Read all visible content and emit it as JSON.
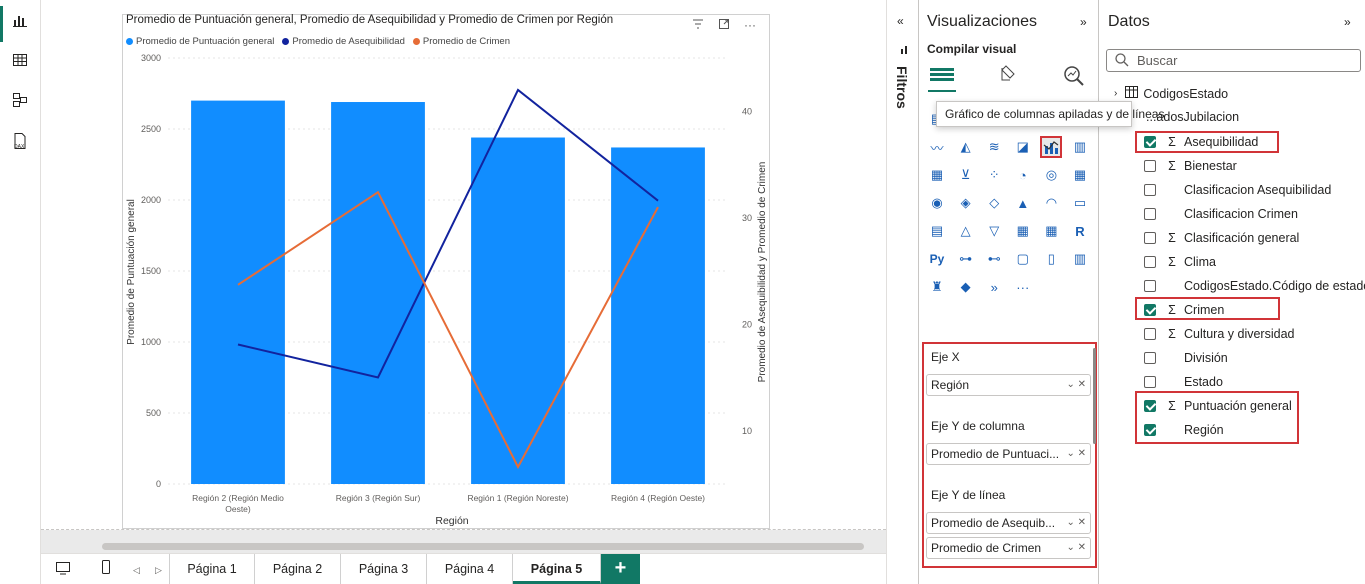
{
  "canvas_tabs": [
    "Página 1",
    "Página 2",
    "Página 3",
    "Página 4",
    "Página 5"
  ],
  "active_tab": "Página 5",
  "add_page_label": "+",
  "filters_label": "Filtros",
  "visualizations": {
    "title": "Visualizaciones",
    "build_visual_label": "Compilar visual",
    "tooltip": "Gráfico de columnas apiladas y de líneas",
    "more_label": "···",
    "wells": {
      "x_axis_label": "Eje X",
      "x_axis_field": "Región",
      "column_y_label": "Eje Y de columna",
      "column_y_field": "Promedio de Puntuaci...",
      "line_y_label": "Eje Y de línea",
      "line_y_fields": [
        "Promedio de Asequib...",
        "Promedio de Crimen"
      ]
    }
  },
  "data_pane": {
    "title": "Datos",
    "search_placeholder": "Buscar",
    "tables": [
      {
        "name": "CodigosEstado"
      },
      {
        "name": "...adosJubilacion"
      }
    ],
    "fields": [
      {
        "name": "Asequibilidad",
        "checked": true,
        "sigma": true
      },
      {
        "name": "Bienestar",
        "checked": false,
        "sigma": true
      },
      {
        "name": "Clasificacion Asequibilidad",
        "checked": false,
        "sigma": false
      },
      {
        "name": "Clasificacion Crimen",
        "checked": false,
        "sigma": false
      },
      {
        "name": "Clasificación general",
        "checked": false,
        "sigma": true
      },
      {
        "name": "Clima",
        "checked": false,
        "sigma": true
      },
      {
        "name": "CodigosEstado.Código de estado",
        "checked": false,
        "sigma": false
      },
      {
        "name": "Crimen",
        "checked": true,
        "sigma": true
      },
      {
        "name": "Cultura y diversidad",
        "checked": false,
        "sigma": true
      },
      {
        "name": "División",
        "checked": false,
        "sigma": false
      },
      {
        "name": "Estado",
        "checked": false,
        "sigma": false
      },
      {
        "name": "Puntuación general",
        "checked": true,
        "sigma": true
      },
      {
        "name": "Región",
        "checked": true,
        "sigma": false
      }
    ]
  },
  "chart_data": {
    "type": "bar",
    "title": "Promedio de Puntuación general, Promedio de Asequibilidad y Promedio de Crimen por Región",
    "xlabel": "Región",
    "ylabel": "Promedio de Puntuación general",
    "y2label": "Promedio de Asequibilidad y Promedio de Crimen",
    "categories": [
      "Región 2 (Región Medio Oeste)",
      "Región 3 (Región Sur)",
      "Región 1 (Región Noreste)",
      "Región 4 (Región Oeste)"
    ],
    "ylim": [
      0,
      3000
    ],
    "y_ticks": [
      0,
      500,
      1000,
      1500,
      2000,
      2500,
      3000
    ],
    "y2lim": [
      5,
      45
    ],
    "y2_ticks": [
      10,
      20,
      30,
      40
    ],
    "series": [
      {
        "name": "Promedio de Puntuación general",
        "kind": "bar",
        "axis": "left",
        "color": "#118DFF",
        "values": [
          2700,
          2690,
          2440,
          2370
        ]
      },
      {
        "name": "Promedio de Asequibilidad",
        "kind": "line",
        "axis": "right",
        "color": "#12239E",
        "values": [
          18.1,
          15.0,
          42.0,
          31.6
        ]
      },
      {
        "name": "Promedio de Crimen",
        "kind": "line",
        "axis": "right",
        "color": "#E66C37",
        "values": [
          23.7,
          32.4,
          6.6,
          31.0
        ]
      }
    ]
  }
}
